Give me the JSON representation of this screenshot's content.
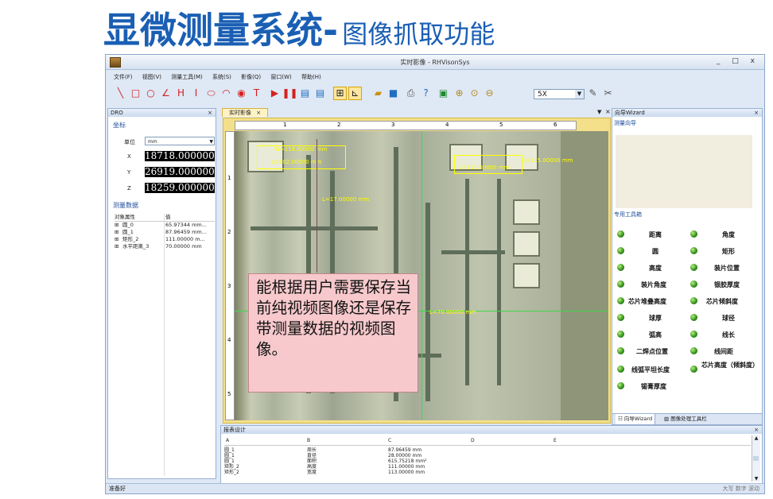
{
  "slide": {
    "title_main": "显微测量系统-",
    "title_sub": "图像抓取功能"
  },
  "window": {
    "title": "实时影像 - RHVisonSys",
    "controls": "_ □ x"
  },
  "menu": [
    "文件(F)",
    "视图(V)",
    "测量工具(M)",
    "系统(S)",
    "影像(Q)",
    "窗口(W)",
    "帮助(H)"
  ],
  "toolbar": {
    "zoom_value": "5X",
    "drawing_tools": [
      "line-icon",
      "rectangle-icon",
      "circle-icon",
      "angle-icon",
      "horizontal-distance-icon",
      "vertical-distance-icon",
      "ellipse-icon",
      "arc-icon",
      "point-icon",
      "text-icon"
    ]
  },
  "dro_panel": {
    "header": "DRO",
    "coords_section": "坐标",
    "unit_label": "单位",
    "unit_value": "mm",
    "x_label": "X",
    "x_value": "18718.000000",
    "y_label": "Y",
    "y_value": "26919.000000",
    "z_label": "Z",
    "z_value": "18259.000000",
    "measure_section": "测量数据",
    "col_attr": "对象属性",
    "col_value": "值",
    "rows": [
      {
        "name": "圆_0",
        "value": "65.97344 mm..."
      },
      {
        "name": "圆_1",
        "value": "87.96459 mm..."
      },
      {
        "name": "矩形_2",
        "value": "111.00000 m..."
      },
      {
        "name": "水平距离_3",
        "value": "70.00000 mm"
      }
    ]
  },
  "viewer": {
    "tab_label": "实时影像",
    "ruler_top": [
      "1",
      "2",
      "3",
      "4",
      "5",
      "6"
    ],
    "ruler_left": [
      "1",
      "2",
      "3",
      "4",
      "5"
    ],
    "measurements": [
      "W=116.00000 mm",
      "L=102.00000 mm",
      "L=111.00000 mm",
      "L=115.00000 mm",
      "L=17.00000 mm",
      "L=70.00000 mm"
    ]
  },
  "wizard": {
    "header": "向导Wizard",
    "section1": "测量向导",
    "section2": "专用工具箱",
    "tools": [
      [
        "距离",
        "角度"
      ],
      [
        "圆",
        "矩形"
      ],
      [
        "高度",
        "装片位置"
      ],
      [
        "装片角度",
        "银胶厚度"
      ],
      [
        "芯片堆叠高度",
        "芯片倾斜度"
      ],
      [
        "球厚",
        "球径"
      ],
      [
        "弧高",
        "线长"
      ],
      [
        "二焊点位置",
        "线间距"
      ],
      [
        "线弧平坦长度",
        "芯片高度（倾斜度）"
      ],
      [
        "锡膏厚度",
        ""
      ]
    ],
    "tab1": "向导Wizard",
    "tab2": "图像处理工具栏"
  },
  "report": {
    "header": "报表设计",
    "columns": [
      "A",
      "B",
      "C",
      "D",
      "E"
    ],
    "rows": [
      [
        "圆_1",
        "周长",
        "87.96459 mm"
      ],
      [
        "圆_1",
        "直径",
        "28.00000 mm"
      ],
      [
        "圆_1",
        "面积",
        "615.75218 mm²"
      ],
      [
        "矩形_2",
        "高度",
        "111.00000 mm"
      ],
      [
        "矩形_2",
        "宽度",
        "113.00000 mm"
      ]
    ]
  },
  "status": {
    "left": "准备好",
    "right": "大写 数字 滚动"
  },
  "callout": {
    "text": "能根据用户需要保存当前纯视频图像还是保存带测量数据的视频图像。"
  }
}
